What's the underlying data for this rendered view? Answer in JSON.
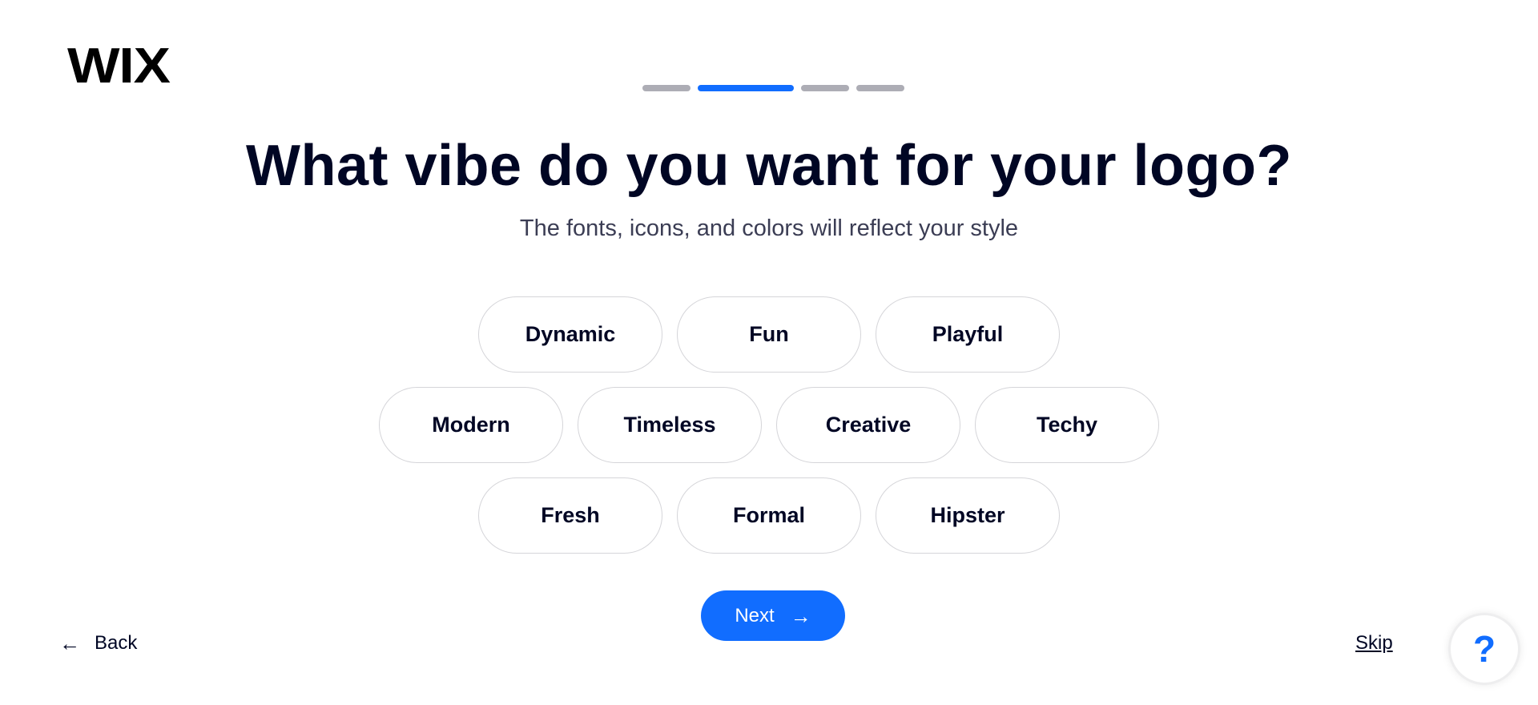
{
  "logo": {
    "text": "WIX"
  },
  "progress": {
    "total_steps": 4,
    "current_step": 2
  },
  "header": {
    "title": "What vibe do you want for your logo?",
    "subtitle": "The fonts, icons, and colors will reflect your style"
  },
  "vibes": {
    "rows": [
      [
        {
          "label": "Dynamic"
        },
        {
          "label": "Fun"
        },
        {
          "label": "Playful"
        }
      ],
      [
        {
          "label": "Modern"
        },
        {
          "label": "Timeless"
        },
        {
          "label": "Creative"
        },
        {
          "label": "Techy"
        }
      ],
      [
        {
          "label": "Fresh"
        },
        {
          "label": "Formal"
        },
        {
          "label": "Hipster"
        }
      ]
    ]
  },
  "actions": {
    "next_label": "Next",
    "next_icon": "arrow-right-icon",
    "back_label": "Back",
    "back_icon": "arrow-left-icon",
    "skip_label": "Skip",
    "help_icon": "question-mark-icon",
    "help_glyph": "?"
  },
  "colors": {
    "accent": "#116dff",
    "text": "#000624",
    "inactive_progress": "#adadb5"
  }
}
